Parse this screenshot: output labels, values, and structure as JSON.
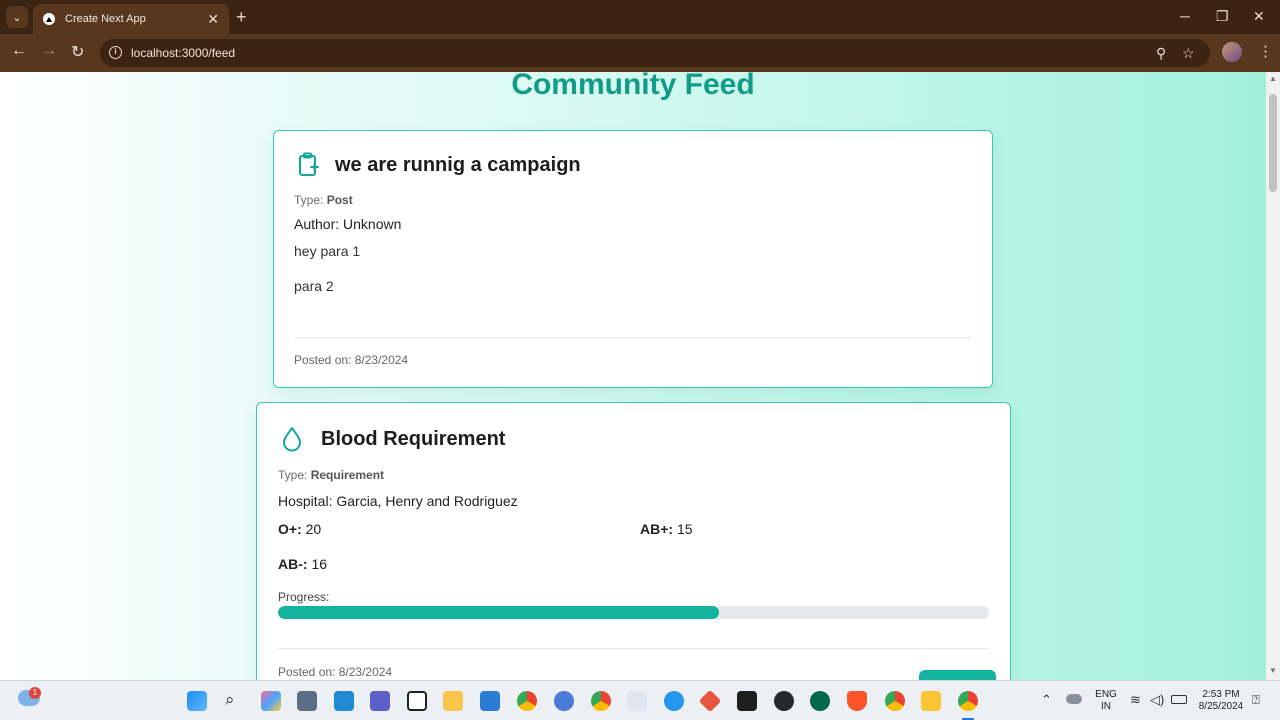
{
  "browser": {
    "tab_title": "Create Next App",
    "tab_close": "✕",
    "new_tab": "+",
    "url": "localhost:3000/feed",
    "window_controls": [
      "─",
      "❐",
      "✕"
    ]
  },
  "page": {
    "heading": "Community Feed",
    "posts": [
      {
        "icon": "clipboard-icon",
        "title": "we are runnig a campaign",
        "type_label": "Type: ",
        "type_value": "Post",
        "author": "Author: Unknown",
        "paragraphs": [
          "hey para 1",
          "para 2"
        ],
        "posted": "Posted on: 8/23/2024"
      },
      {
        "icon": "droplet-icon",
        "title": "Blood Requirement",
        "type_label": "Type: ",
        "type_value": "Requirement",
        "hospital": "Hospital: Garcia, Henry and Rodriguez",
        "blood_groups": [
          {
            "group": "O+:",
            "units": "20"
          },
          {
            "group": "AB+:",
            "units": "15"
          },
          {
            "group": "AB-:",
            "units": "16"
          }
        ],
        "progress_label": "Progress:",
        "progress_fraction": 0.62,
        "posted": "Posted on: 8/23/2024"
      }
    ]
  },
  "taskbar": {
    "notification_count": "1",
    "lang_line1": "ENG",
    "lang_line2": "IN",
    "time": "2:53 PM",
    "date": "8/25/2024"
  },
  "colors": {
    "accent": "#14b3a0",
    "heading": "#139b8a",
    "card_border": "#3ccab6"
  }
}
